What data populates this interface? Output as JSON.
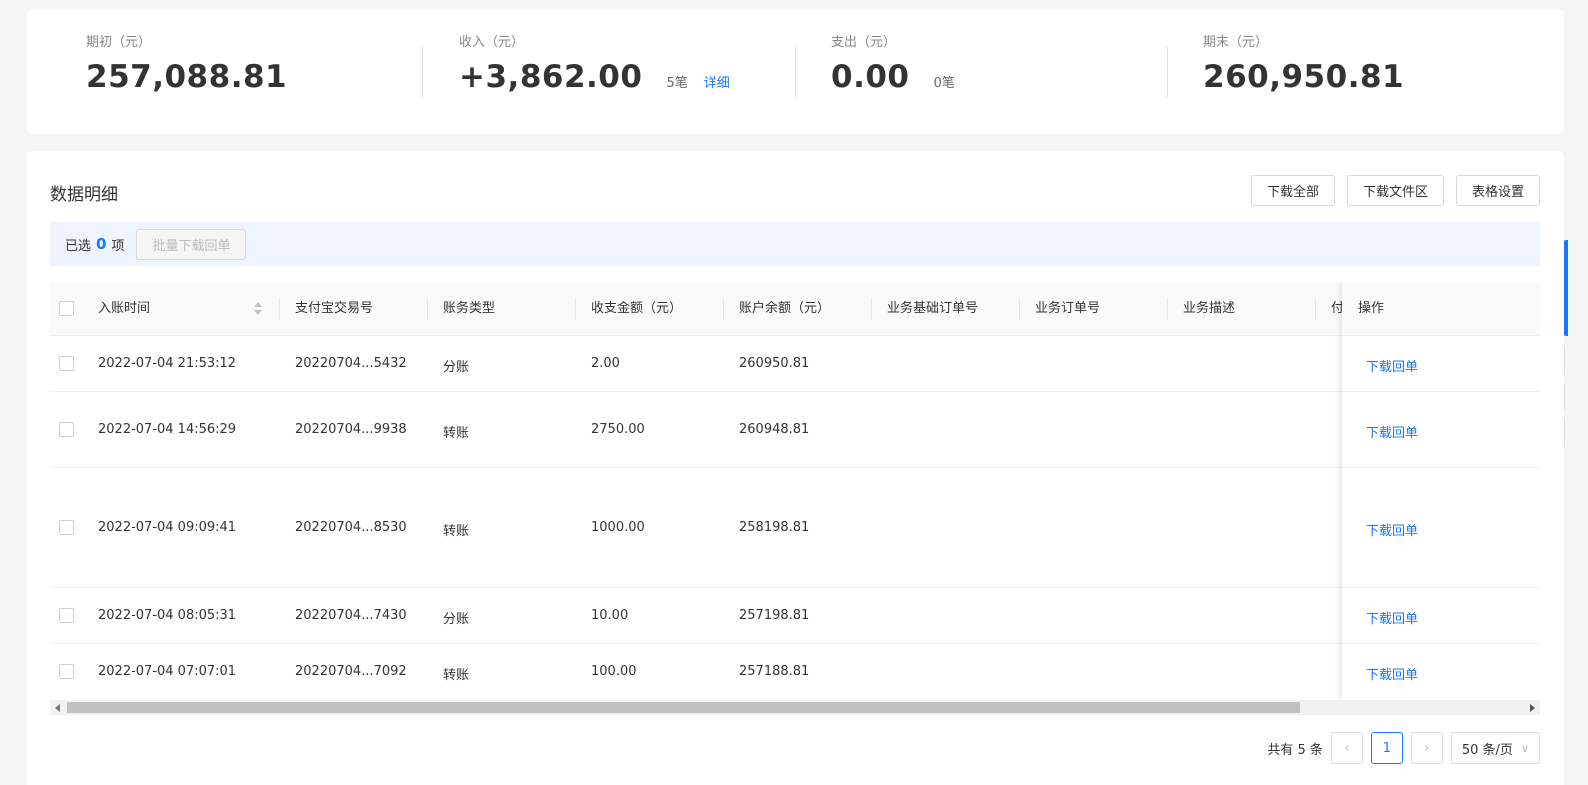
{
  "summary": {
    "opening": {
      "label": "期初（元）",
      "value": "257,088.81"
    },
    "income": {
      "label": "收入（元）",
      "value": "+3,862.00",
      "count": "5笔",
      "detail": "详细"
    },
    "expense": {
      "label": "支出（元）",
      "value": "0.00",
      "count": "0笔"
    },
    "closing": {
      "label": "期末（元）",
      "value": "260,950.81"
    }
  },
  "detail": {
    "title": "数据明细",
    "toolbar": {
      "download_all": "下载全部",
      "download_area": "下载文件区",
      "table_settings": "表格设置"
    },
    "selection": {
      "prefix": "已选",
      "count": "0",
      "suffix": "项",
      "bulk_button": "批量下载回单"
    }
  },
  "table": {
    "headers": {
      "time": "入账时间",
      "trade_no": "支付宝交易号",
      "type": "账务类型",
      "amount": "收支金额（元）",
      "balance": "账户余额（元）",
      "base_order": "业务基础订单号",
      "order": "业务订单号",
      "desc": "业务描述",
      "partial": "付",
      "action": "操作"
    },
    "rows": [
      {
        "time": "2022-07-04 21:53:12",
        "trade_no": "20220704...5432",
        "type": "分账",
        "amount": "2.00",
        "balance": "260950.81",
        "action": "下载回单"
      },
      {
        "time": "2022-07-04 14:56:29",
        "trade_no": "20220704...9938",
        "type": "转账",
        "amount": "2750.00",
        "balance": "260948.81",
        "action": "下载回单"
      },
      {
        "time": "2022-07-04 09:09:41",
        "trade_no": "20220704...8530",
        "type": "转账",
        "amount": "1000.00",
        "balance": "258198.81",
        "action": "下载回单"
      },
      {
        "time": "2022-07-04 08:05:31",
        "trade_no": "20220704...7430",
        "type": "分账",
        "amount": "10.00",
        "balance": "257198.81",
        "action": "下载回单"
      },
      {
        "time": "2022-07-04 07:07:01",
        "trade_no": "20220704...7092",
        "type": "转账",
        "amount": "100.00",
        "balance": "257188.81",
        "action": "下载回单"
      }
    ]
  },
  "pagination": {
    "total": "共有 5 条",
    "current_page": "1",
    "page_size": "50 条/页",
    "prev_icon": "chevron-left-icon",
    "next_icon": "chevron-right-icon"
  },
  "colors": {
    "accent": "#1677ff",
    "selection_bg": "#edf4ff"
  }
}
